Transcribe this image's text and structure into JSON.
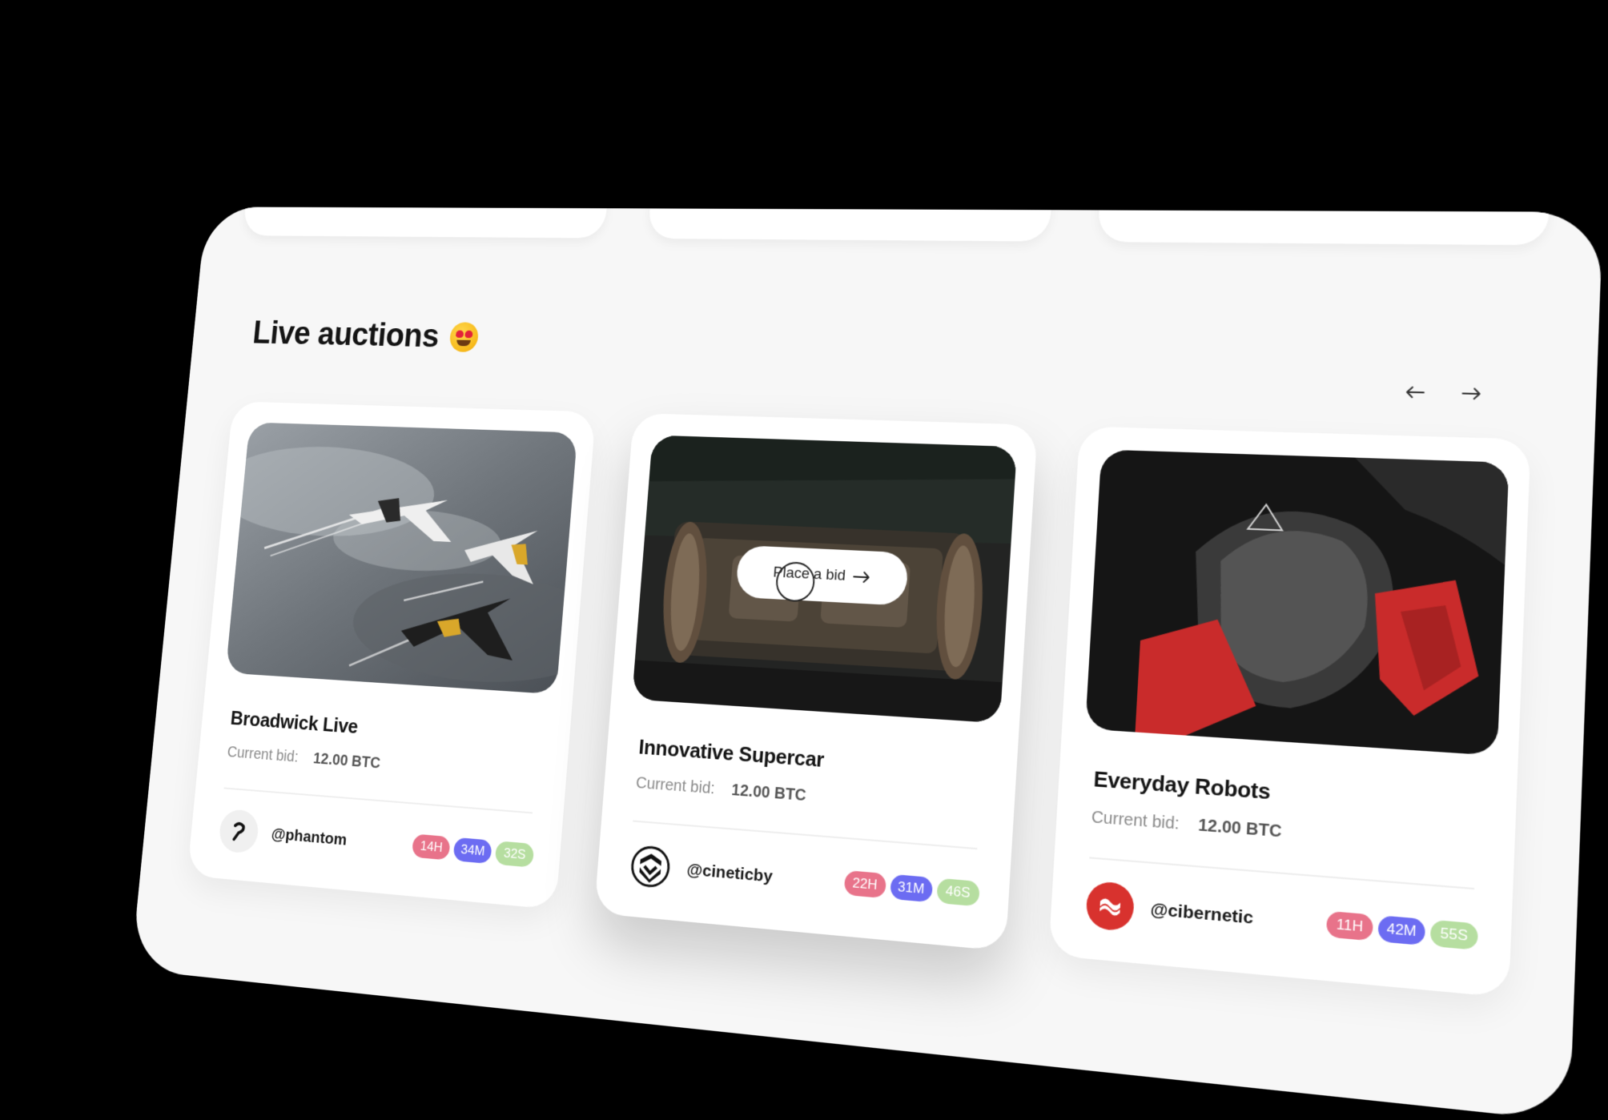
{
  "section": {
    "title": "Live auctions",
    "emoji_icon": "heart-eyes-emoji"
  },
  "nav": {
    "prev_icon": "arrow-left-icon",
    "next_icon": "arrow-right-icon"
  },
  "colors": {
    "hours": "#e8738a",
    "minutes": "#6c6cf2",
    "seconds": "#b6dea0",
    "panel": "#f7f7f7",
    "card": "#ffffff"
  },
  "cards": [
    {
      "name": "Broadwick Live",
      "bid_label": "Current bid:",
      "bid_value": "12.00 BTC",
      "handle": "@phantom",
      "hours": "14H",
      "minutes": "34M",
      "seconds": "32S",
      "image": "three-jets-flying-over-clouds",
      "avatar_icon": "phantom-logo-icon"
    },
    {
      "name": "Innovative Supercar",
      "bid_label": "Current bid:",
      "bid_value": "12.00 BTC",
      "handle": "@cineticby",
      "hours": "22H",
      "minutes": "31M",
      "seconds": "46S",
      "image": "concept-car-open-doors",
      "avatar_icon": "cineticby-logo-icon",
      "cta": "Place a bid"
    },
    {
      "name": "Everyday Robots",
      "bid_label": "Current bid:",
      "bid_value": "12.00 BTC",
      "handle": "@cibernetic",
      "hours": "11H",
      "minutes": "42M",
      "seconds": "55S",
      "image": "carbon-fiber-robot-red-armor",
      "avatar_icon": "cibernetic-logo-icon"
    }
  ]
}
